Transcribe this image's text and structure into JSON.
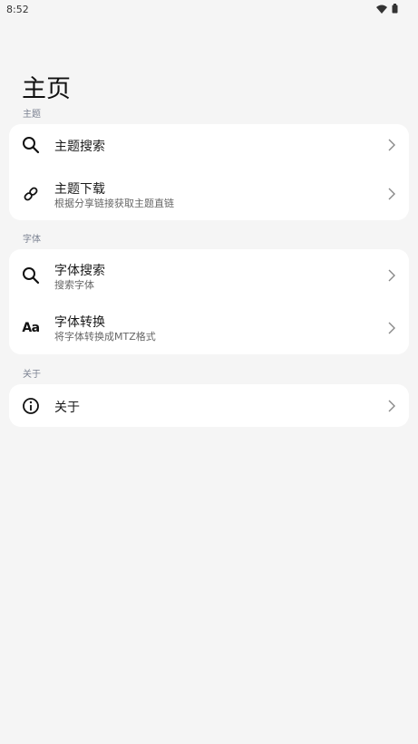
{
  "status_bar": {
    "time": "8:52"
  },
  "page_title": "主页",
  "sections": {
    "theme": {
      "title": "主题",
      "items": [
        {
          "title": "主题搜索",
          "icon": "search-icon"
        },
        {
          "title": "主题下载",
          "subtitle": "根据分享链接获取主题直链",
          "icon": "link-icon"
        }
      ]
    },
    "font": {
      "title": "字体",
      "items": [
        {
          "title": "字体搜索",
          "subtitle": "搜索字体",
          "icon": "search-icon"
        },
        {
          "title": "字体转换",
          "subtitle": "将字体转换成MTZ格式",
          "icon": "font-icon",
          "icon_text": "Aa"
        }
      ]
    },
    "about": {
      "title": "关于",
      "items": [
        {
          "title": "关于",
          "icon": "info-icon"
        }
      ]
    }
  },
  "colors": {
    "background": "#f5f5f5",
    "card": "#ffffff",
    "section_title": "#7a8191",
    "text_primary": "#1a1a1a",
    "text_secondary": "#666666"
  }
}
